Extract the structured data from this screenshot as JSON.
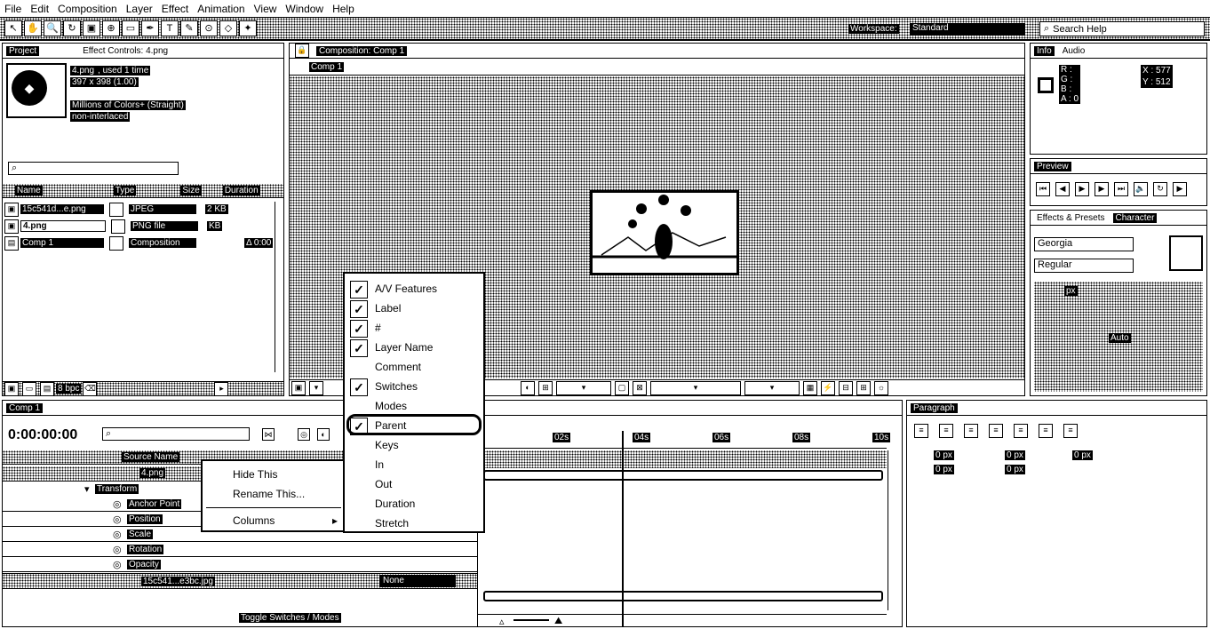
{
  "menubar": [
    "File",
    "Edit",
    "Composition",
    "Layer",
    "Effect",
    "Animation",
    "View",
    "Window",
    "Help"
  ],
  "toolbar": {
    "workspace_label": "Workspace:",
    "workspace_value": "Standard",
    "search_placeholder": "Search Help"
  },
  "project_panel": {
    "tabs": [
      "Project",
      "Effect Controls: 4.png"
    ],
    "asset_name": "4.png",
    "used": ", used 1 time",
    "dimensions": "397 x 398 (1.00)",
    "color_info": "Millions of Colors+ (Straight)",
    "interlace": "non-interlaced",
    "columns": [
      "Name",
      "Type",
      "Size",
      "Duration"
    ],
    "items": [
      {
        "name": "15c541d...e.png",
        "type": "JPEG",
        "size": "2 KB",
        "selected": true
      },
      {
        "name": "4.png",
        "type": "PNG file",
        "size": "KB",
        "selected": false,
        "editing": true
      },
      {
        "name": "Comp 1",
        "type": "Composition",
        "size": "",
        "duration": "Δ 0:00",
        "selected": false
      }
    ],
    "bpc": "8 bpc"
  },
  "composition_panel": {
    "tab": "Composition: Comp 1",
    "comp_button": "Comp 1"
  },
  "info_panel": {
    "tabs": [
      "Info",
      "Audio"
    ],
    "r": "R :",
    "g": "G :",
    "b": "B :",
    "a": "A : 0",
    "x": "X : 577",
    "y": "Y : 512"
  },
  "preview_panel": {
    "tab": "Preview"
  },
  "character_panel": {
    "tabs": [
      "Effects & Presets",
      "Character"
    ],
    "font": "Georgia",
    "style": "Regular",
    "px_label": "px",
    "auto_label": "Auto"
  },
  "paragraph_panel": {
    "tab": "Paragraph",
    "values": [
      "0 px",
      "0 px",
      "0 px",
      "0 px",
      "0 px"
    ]
  },
  "timeline": {
    "tab": "Comp 1",
    "timecode": "0:00:00:00",
    "source_header": "Source Name",
    "layer1_name": "4.png",
    "layer2_name": "15c541...e3bc.jpg",
    "transform": "Transform",
    "properties": [
      "Anchor Point",
      "Position",
      "Scale",
      "Rotation",
      "Opacity"
    ],
    "parent_value": "None",
    "toggle_label": "Toggle Switches / Modes",
    "ruler_ticks": [
      "02s",
      "04s",
      "06s",
      "08s",
      "10s"
    ]
  },
  "context_menu_1": {
    "items": [
      "Hide This",
      "Rename This...",
      "Columns"
    ]
  },
  "context_menu_2": {
    "items": [
      {
        "label": "A/V Features",
        "checked": true
      },
      {
        "label": "Label",
        "checked": true
      },
      {
        "label": "#",
        "checked": true
      },
      {
        "label": "Layer Name",
        "checked": true
      },
      {
        "label": "Comment",
        "checked": false
      },
      {
        "label": "Switches",
        "checked": true
      },
      {
        "label": "Modes",
        "checked": false
      },
      {
        "label": "Parent",
        "checked": true
      },
      {
        "label": "Keys",
        "checked": false
      },
      {
        "label": "In",
        "checked": false
      },
      {
        "label": "Out",
        "checked": false
      },
      {
        "label": "Duration",
        "checked": false
      },
      {
        "label": "Stretch",
        "checked": false
      }
    ]
  }
}
